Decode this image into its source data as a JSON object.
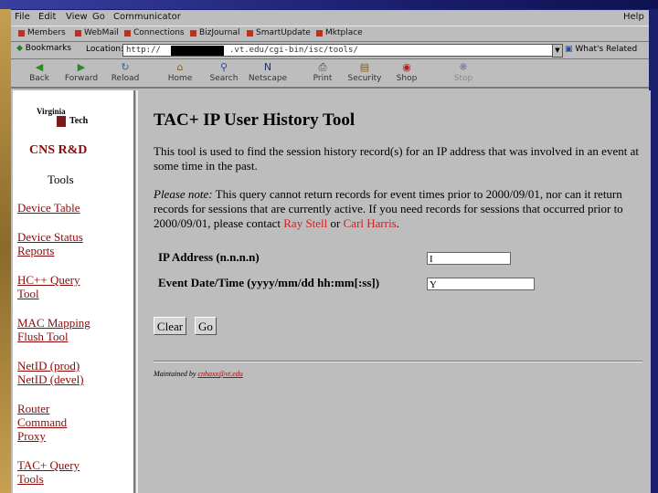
{
  "menubar": {
    "items": [
      "File",
      "Edit",
      "View",
      "Go",
      "Communicator"
    ],
    "help": "Help"
  },
  "personal_toolbar": [
    "Members",
    "WebMail",
    "Connections",
    "BizJournal",
    "SmartUpdate",
    "Mktplace"
  ],
  "location": {
    "bookmarks": "Bookmarks",
    "label": "Location:",
    "url_prefix": "http://",
    "url_suffix": ".vt.edu/cgi-bin/isc/tools/",
    "related": "What's Related"
  },
  "nav_toolbar": [
    {
      "label": "Back",
      "icon": "back-arrow-icon"
    },
    {
      "label": "Forward",
      "icon": "forward-arrow-icon"
    },
    {
      "label": "Reload",
      "icon": "reload-icon"
    },
    {
      "label": "Home",
      "icon": "home-icon"
    },
    {
      "label": "Search",
      "icon": "search-icon"
    },
    {
      "label": "Netscape",
      "icon": "netscape-icon"
    },
    {
      "label": "Print",
      "icon": "print-icon"
    },
    {
      "label": "Security",
      "icon": "lock-icon"
    },
    {
      "label": "Shop",
      "icon": "shop-icon"
    },
    {
      "label": "Stop",
      "icon": "stop-icon"
    }
  ],
  "sidebar": {
    "logo_top": "Virginia",
    "logo_bottom": "Tech",
    "dept": "CNS R&D",
    "heading": "Tools",
    "links": [
      {
        "lines": [
          "Device Table"
        ]
      },
      {
        "lines": [
          "Device Status",
          "Reports"
        ]
      },
      {
        "lines": [
          "HC++ Query",
          "Tool"
        ]
      },
      {
        "lines": [
          "MAC Mapping",
          "Flush Tool"
        ]
      },
      {
        "lines": [
          "NetID (prod)",
          "NetID (devel)"
        ]
      },
      {
        "lines": [
          "Router",
          "Command",
          "Proxy"
        ]
      },
      {
        "lines": [
          "TAC+ Query",
          "Tools"
        ]
      }
    ]
  },
  "main": {
    "title": "TAC+ IP User History Tool",
    "intro": "This tool is used to find the session history record(s) for an IP address that was involved in an event at some time in the past.",
    "note_label": "Please note:",
    "note_text": " This query cannot return records for event times prior to 2000/09/01, nor can it return records for sessions that are currently active. If you need records for sessions that occurred prior to 2000/09/01, please contact ",
    "contact1": "Ray Stell",
    "or": " or ",
    "contact2": "Carl Harris",
    "period": ".",
    "ip_label": "IP Address (n.n.n.n)",
    "ip_value": "I",
    "date_label": "Event Date/Time (yyyy/mm/dd hh:mm[:ss])",
    "date_value": "Y",
    "clear_label": "Clear",
    "go_label": "Go",
    "maintained_prefix": "Maintained by ",
    "maintained_link": "cnhaxx@vt.edu"
  },
  "colors": {
    "link": "#8b0a0a",
    "contact": "#d02020",
    "frame_bg": "#bdbdbd"
  }
}
